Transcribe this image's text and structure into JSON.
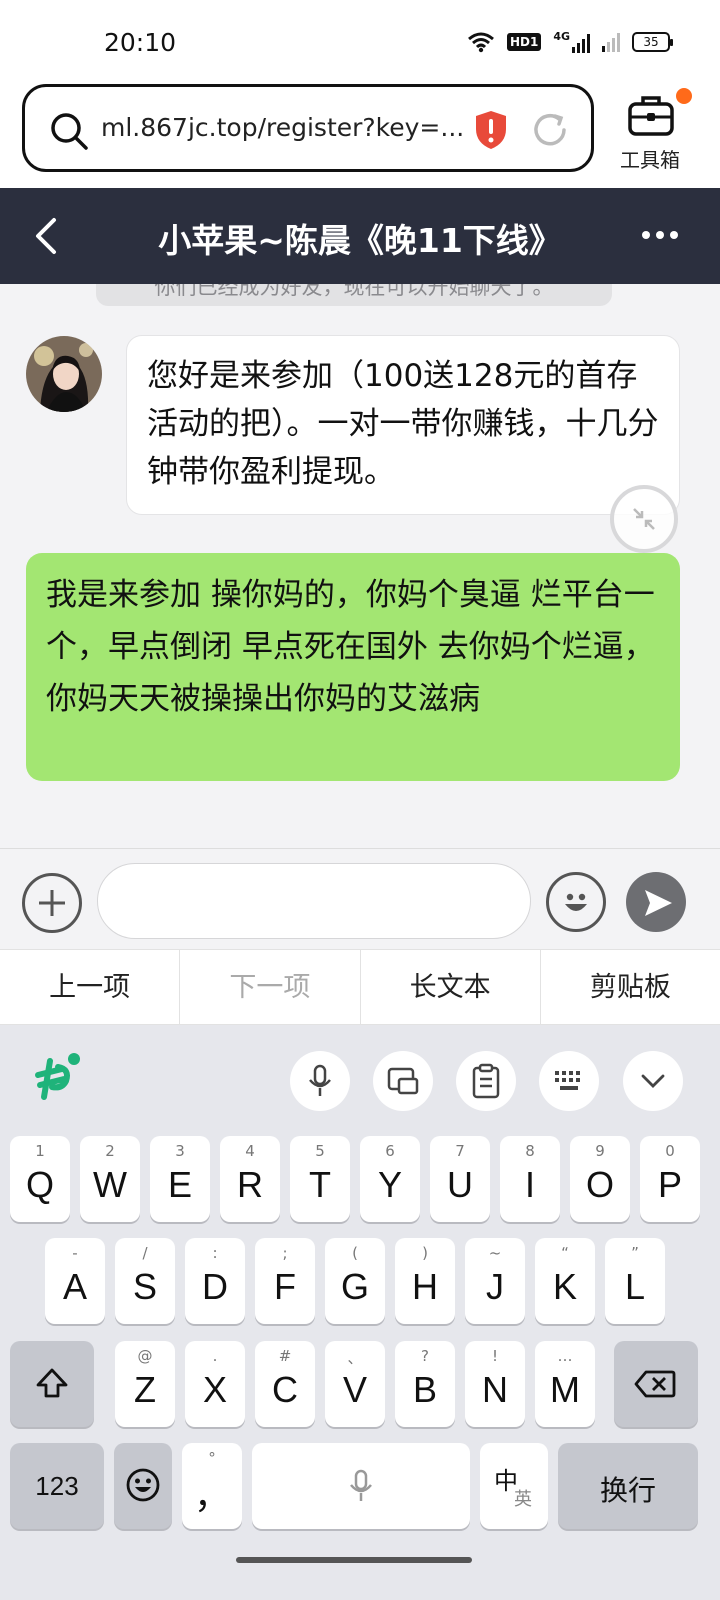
{
  "status_bar": {
    "time": "20:10",
    "hd_label": "HD1",
    "signal_label": "4G",
    "battery": "35"
  },
  "browser": {
    "url": "ml.867jc.top/register?key=...",
    "toolbox_label": "工具箱"
  },
  "chat": {
    "title": "小苹果~陈晨《晚11下线》",
    "system_message": "你们已经成为好友，现在可以开始聊天了。",
    "incoming_message": "您好是来参加（100送128元的首存活动的把）。一对一带你赚钱，十几分钟带你盈利提现。",
    "outgoing_message": "我是来参加 操你妈的，你妈个臭逼 烂平台一个，早点倒闭 早点死在国外 去你妈个烂逼，你妈天天被操操出你妈的艾滋病"
  },
  "input": {
    "placeholder": ""
  },
  "suggestions": {
    "prev": "上一项",
    "next": "下一项",
    "long_text": "长文本",
    "clipboard": "剪贴板"
  },
  "keyboard": {
    "row1": [
      {
        "hint": "1",
        "key": "Q"
      },
      {
        "hint": "2",
        "key": "W"
      },
      {
        "hint": "3",
        "key": "E"
      },
      {
        "hint": "4",
        "key": "R"
      },
      {
        "hint": "5",
        "key": "T"
      },
      {
        "hint": "6",
        "key": "Y"
      },
      {
        "hint": "7",
        "key": "U"
      },
      {
        "hint": "8",
        "key": "I"
      },
      {
        "hint": "9",
        "key": "O"
      },
      {
        "hint": "0",
        "key": "P"
      }
    ],
    "row2": [
      {
        "hint": "-",
        "key": "A"
      },
      {
        "hint": "/",
        "key": "S"
      },
      {
        "hint": ":",
        "key": "D"
      },
      {
        "hint": ";",
        "key": "F"
      },
      {
        "hint": "(",
        "key": "G"
      },
      {
        "hint": ")",
        "key": "H"
      },
      {
        "hint": "~",
        "key": "J"
      },
      {
        "hint": "“",
        "key": "K"
      },
      {
        "hint": "”",
        "key": "L"
      }
    ],
    "row3": [
      {
        "hint": "@",
        "key": "Z"
      },
      {
        "hint": ".",
        "key": "X"
      },
      {
        "hint": "#",
        "key": "C"
      },
      {
        "hint": "、",
        "key": "V"
      },
      {
        "hint": "?",
        "key": "B"
      },
      {
        "hint": "!",
        "key": "N"
      },
      {
        "hint": "…",
        "key": "M"
      }
    ],
    "num_key": "123",
    "comma_hint": "°",
    "comma_key": "，",
    "lang_key_main": "中",
    "lang_key_sub": "英",
    "enter_key": "换行"
  }
}
